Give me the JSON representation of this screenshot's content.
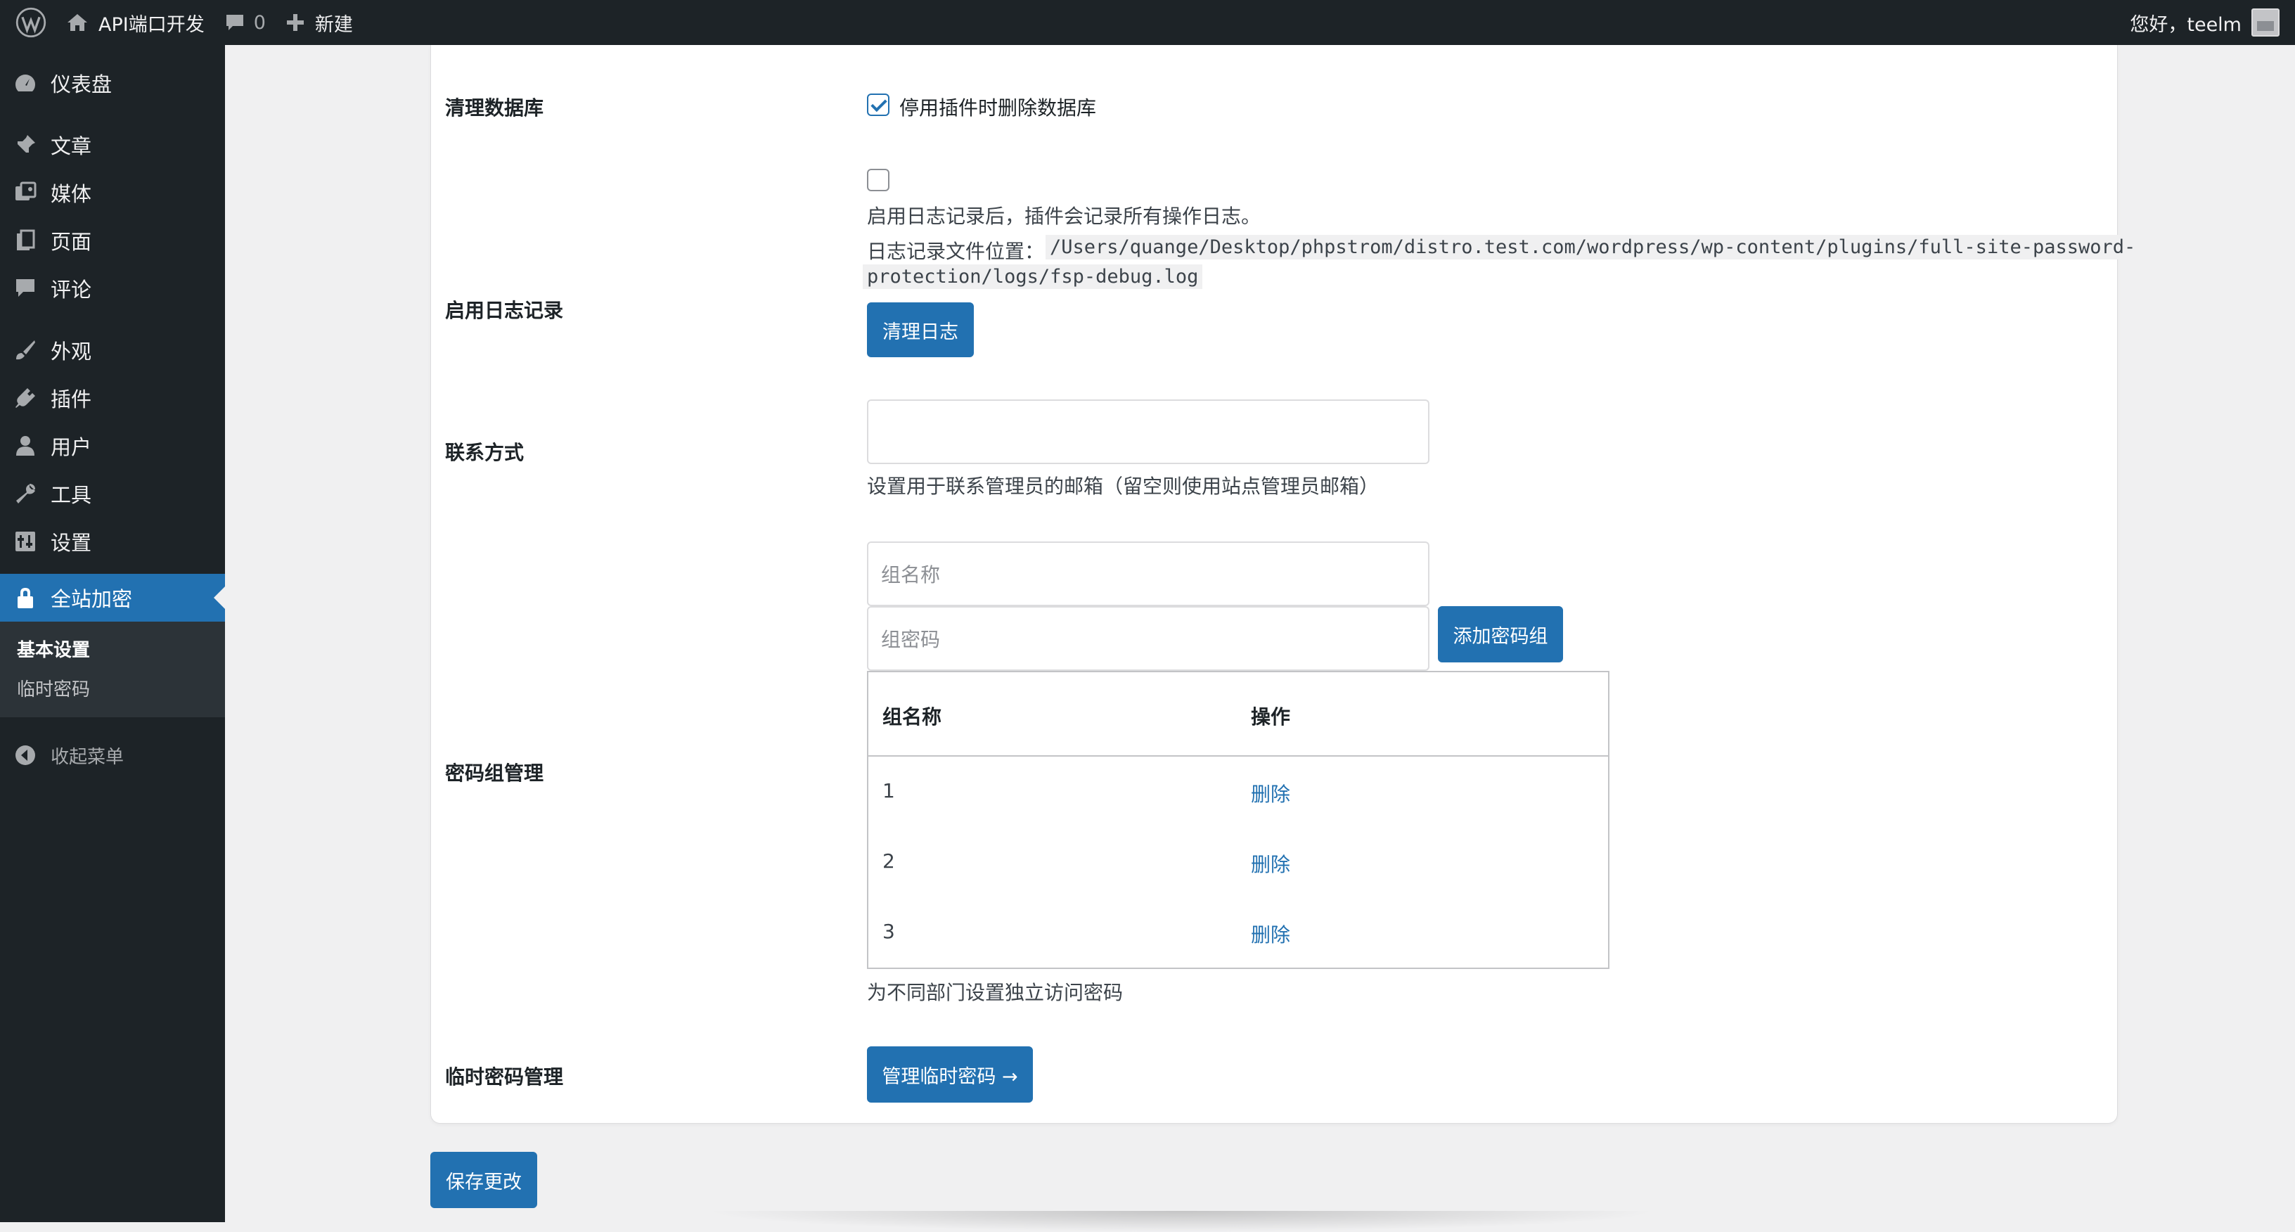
{
  "adminbar": {
    "site_name": "API端口开发",
    "comments_count": "0",
    "new_label": "新建",
    "greeting": "您好，teelm"
  },
  "sidebar": {
    "items": [
      {
        "label": "仪表盘",
        "icon": "dashboard-icon"
      },
      {
        "label": "文章",
        "icon": "pin-icon"
      },
      {
        "label": "媒体",
        "icon": "media-icon"
      },
      {
        "label": "页面",
        "icon": "page-icon"
      },
      {
        "label": "评论",
        "icon": "comment-icon"
      },
      {
        "label": "外观",
        "icon": "brush-icon"
      },
      {
        "label": "插件",
        "icon": "plugin-icon"
      },
      {
        "label": "用户",
        "icon": "user-icon"
      },
      {
        "label": "工具",
        "icon": "wrench-icon"
      },
      {
        "label": "设置",
        "icon": "settings-icon"
      },
      {
        "label": "全站加密",
        "icon": "lock-icon"
      }
    ],
    "submenu": [
      {
        "label": "基本设置"
      },
      {
        "label": "临时密码"
      }
    ],
    "collapse_label": "收起菜单"
  },
  "settings": {
    "cleanup": {
      "label": "清理数据库",
      "checkbox_label": "停用插件时删除数据库",
      "checked": true
    },
    "logging": {
      "label": "启用日志记录",
      "checked": false,
      "description": "启用日志记录后，插件会记录所有操作日志。",
      "path_label": "日志记录文件位置：",
      "path_line1": "/Users/quange/Desktop/phpstrom/distro.test.com/wordpress/wp-content/plugins/full-site-password-",
      "path_line2": "protection/logs/fsp-debug.log",
      "clear_button": "清理日志"
    },
    "contact": {
      "label": "联系方式",
      "value": "",
      "description": "设置用于联系管理员的邮箱（留空则使用站点管理员邮箱）"
    },
    "groups": {
      "label": "密码组管理",
      "name_placeholder": "组名称",
      "password_placeholder": "组密码",
      "add_button": "添加密码组",
      "columns": [
        "组名称",
        "操作"
      ],
      "rows": [
        {
          "name": "1",
          "action": "删除"
        },
        {
          "name": "2",
          "action": "删除"
        },
        {
          "name": "3",
          "action": "删除"
        }
      ],
      "description": "为不同部门设置独立访问密码"
    },
    "temp": {
      "label": "临时密码管理",
      "button": "管理临时密码 →"
    }
  },
  "save_button": "保存更改",
  "colors": {
    "admin_bg": "#1d2327",
    "accent": "#2271b1",
    "page_bg": "#f0f0f1"
  }
}
